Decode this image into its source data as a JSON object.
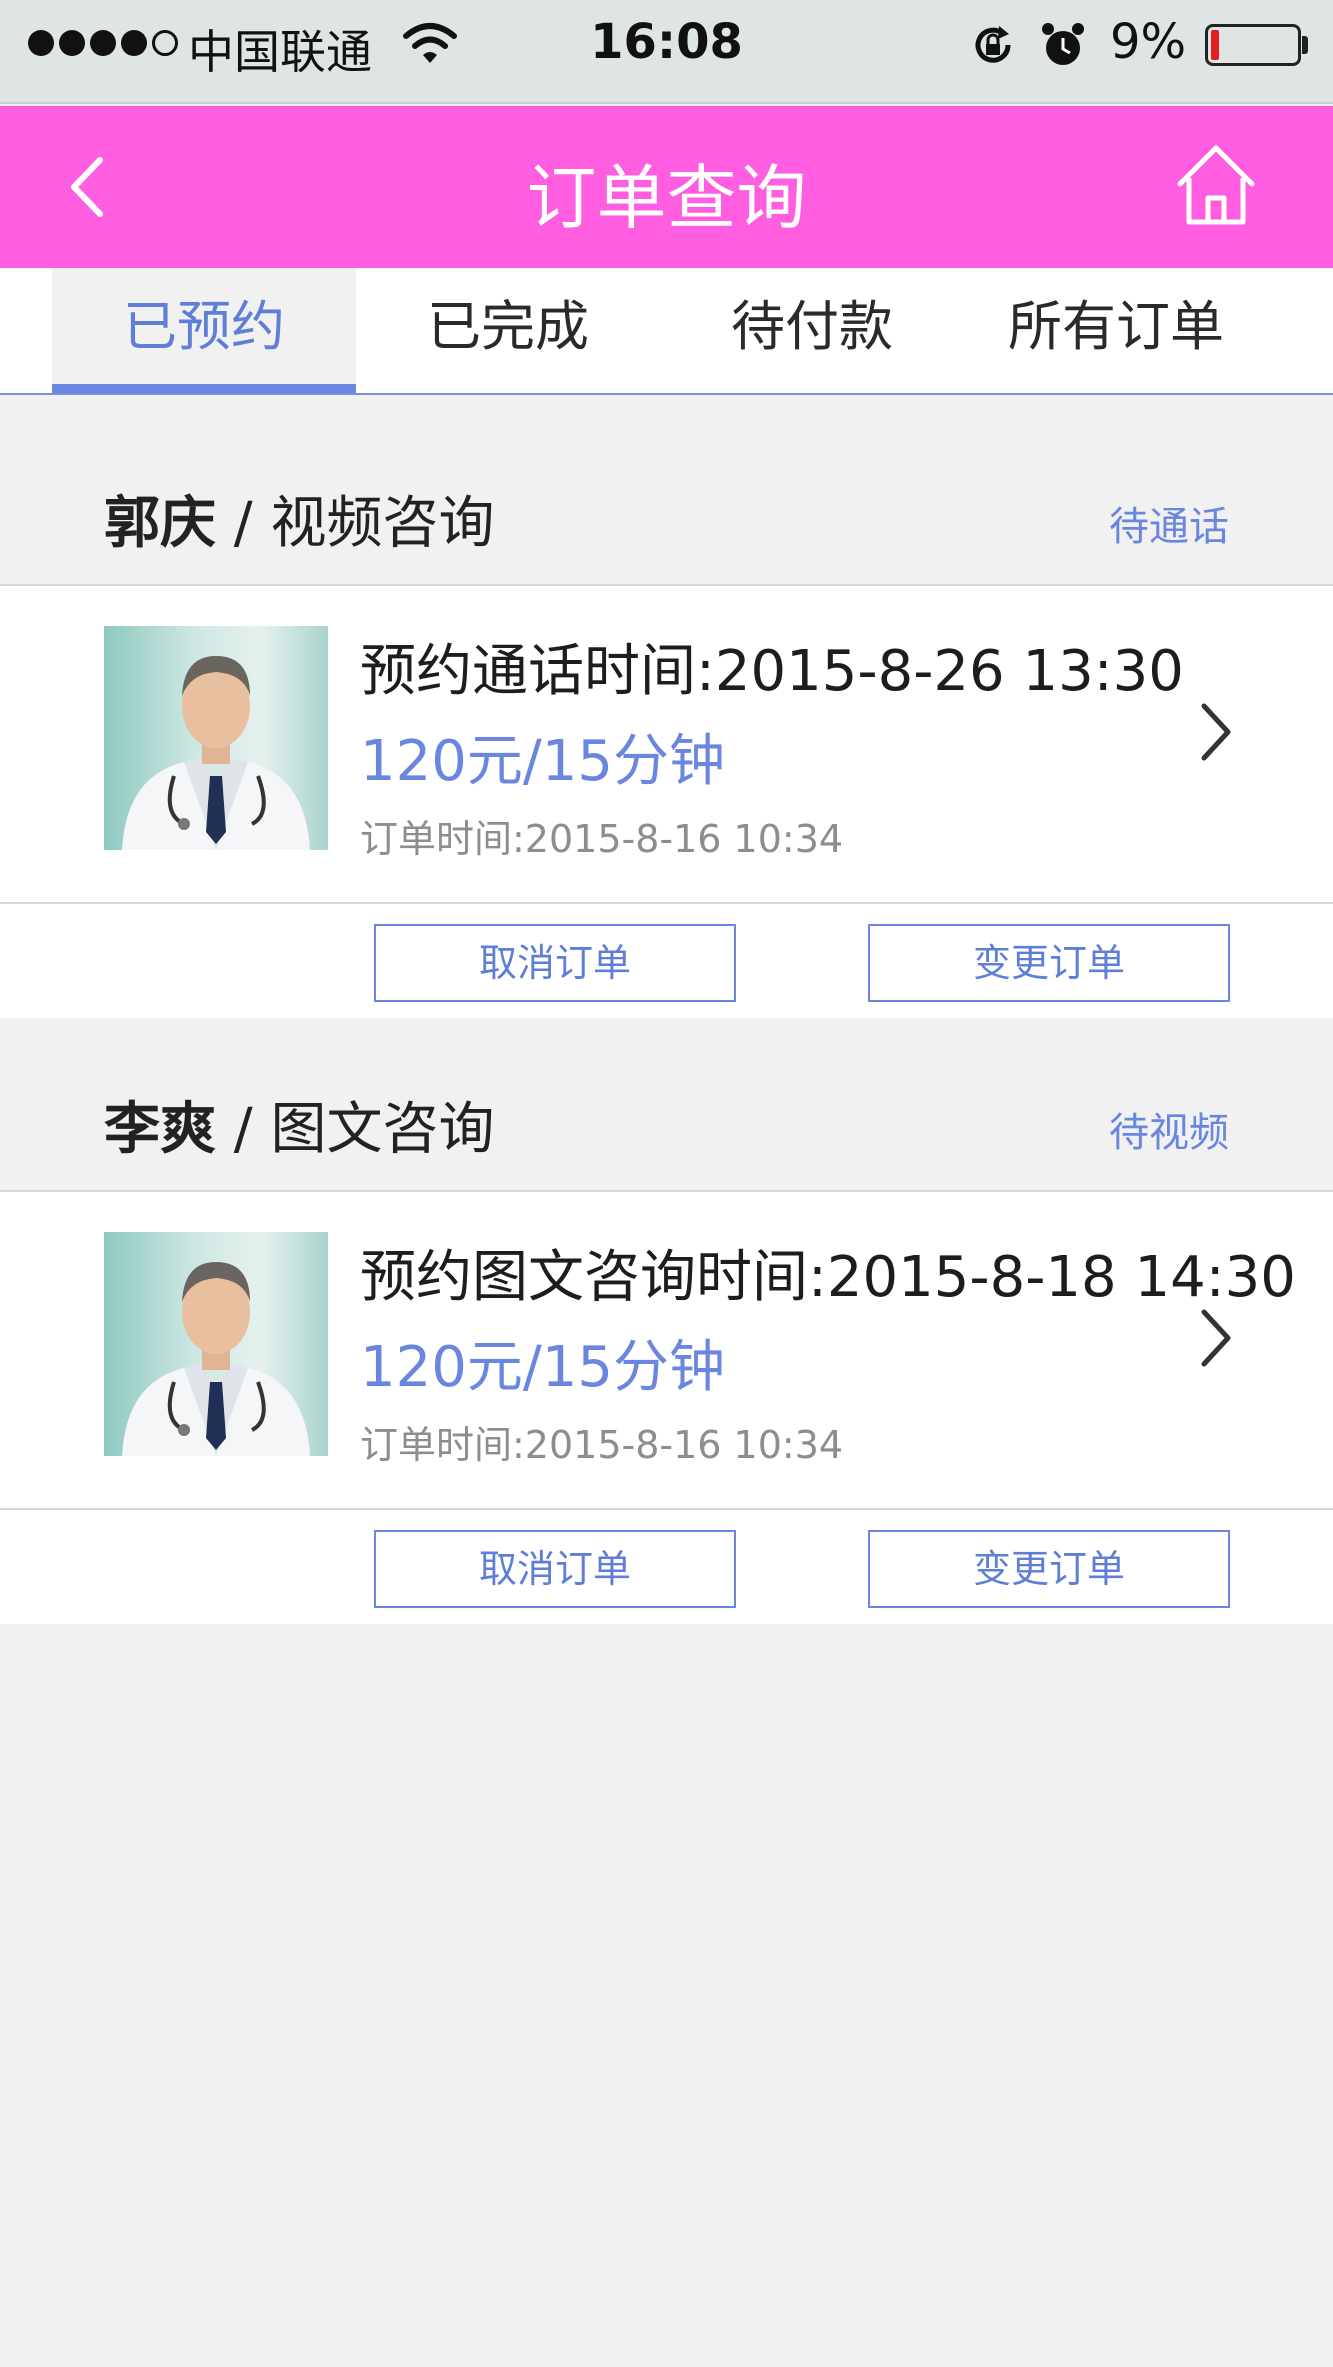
{
  "status_bar": {
    "carrier": "中国联通",
    "time": "16:08",
    "battery": "9%",
    "battery_level": 0.09
  },
  "header": {
    "title": "订单查询"
  },
  "tabs": [
    {
      "label": "已预约",
      "active": true
    },
    {
      "label": "已完成",
      "active": false
    },
    {
      "label": "待付款",
      "active": false
    },
    {
      "label": "所有订单",
      "active": false
    }
  ],
  "orders": [
    {
      "name": "郭庆",
      "separator": " / ",
      "type": "视频咨询",
      "status": "待通话",
      "appointment": "预约通话时间:2015-8-26  13:30",
      "price": "120元/15分钟",
      "created": "订单时间:2015-8-16  10:34",
      "cancel_label": "取消订单",
      "change_label": "变更订单"
    },
    {
      "name": "李爽",
      "separator": " / ",
      "type": "图文咨询",
      "status": "待视频",
      "appointment": "预约图文咨询时间:2015-8-18  14:30",
      "price": "120元/15分钟",
      "created": "订单时间:2015-8-16  10:34",
      "cancel_label": "取消订单",
      "change_label": "变更订单"
    }
  ],
  "colors": {
    "header_bg": "#ff5ee1",
    "accent": "#6b86e0",
    "page_bg": "#f1f1f1"
  }
}
